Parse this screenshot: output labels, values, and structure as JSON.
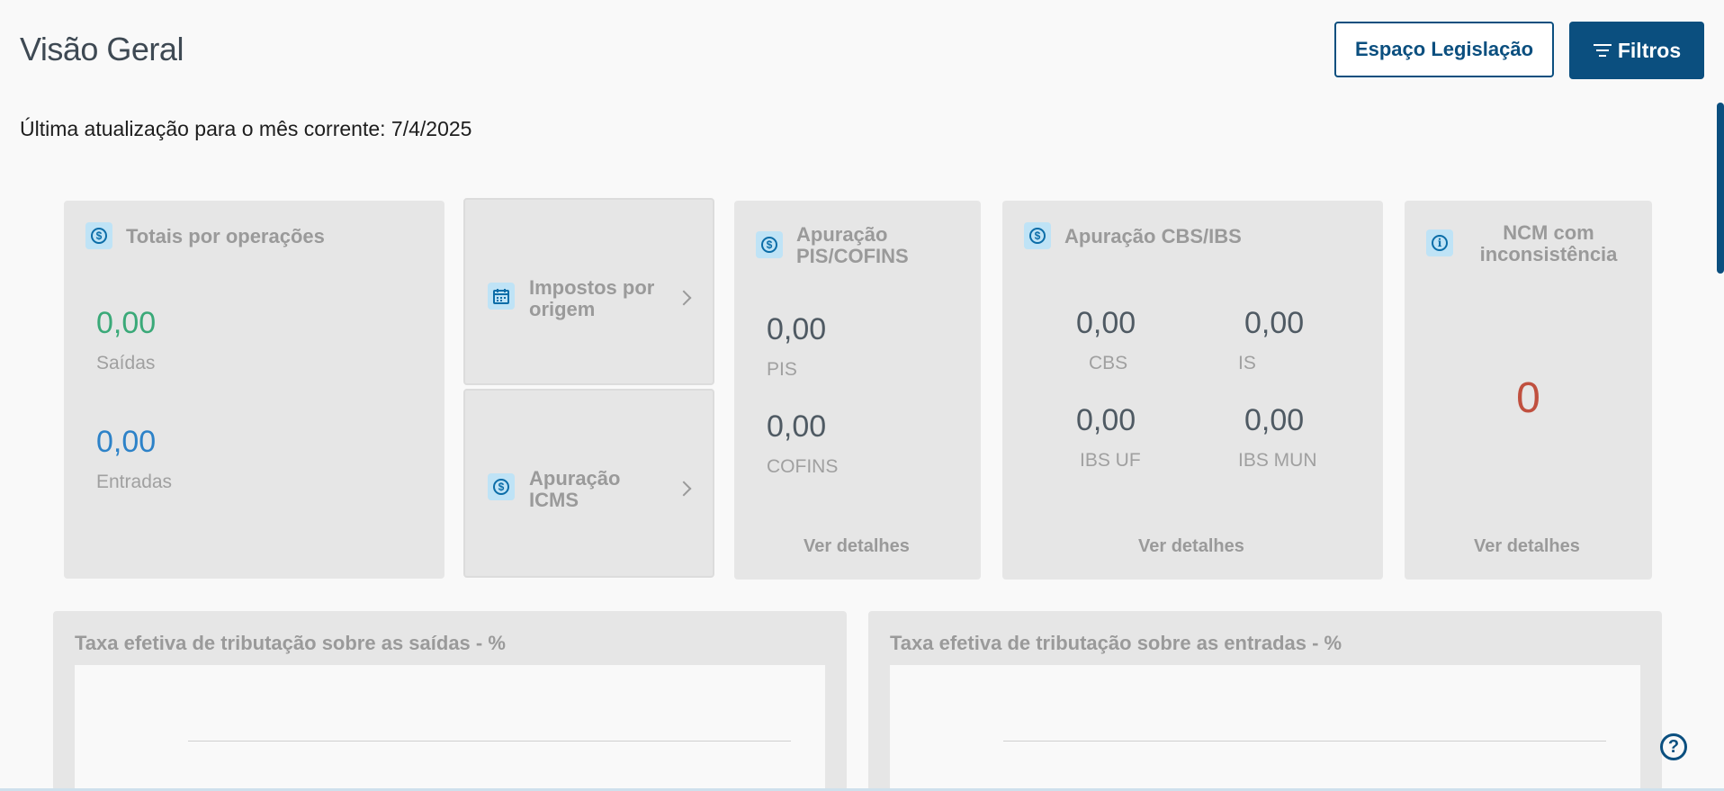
{
  "header": {
    "title": "Visão Geral",
    "legislation_button": "Espaço Legislação",
    "filters_button": "Filtros"
  },
  "last_update": "Última atualização para o mês corrente: 7/4/2025",
  "cards": {
    "totals": {
      "title": "Totais por operações",
      "icon": "dollar-coin-icon",
      "outputs_value": "0,00",
      "outputs_label": "Saídas",
      "inputs_value": "0,00",
      "inputs_label": "Entradas"
    },
    "taxes_origin": {
      "title_line1": "Impostos por",
      "title_line2": "origem",
      "icon": "calendar-icon"
    },
    "icms": {
      "title_line1": "Apuração",
      "title_line2": "ICMS",
      "icon": "dollar-coin-icon"
    },
    "pis_cofins": {
      "title_line1": "Apuração",
      "title_line2": "PIS/COFINS",
      "pis_value": "0,00",
      "pis_label": "PIS",
      "cofins_value": "0,00",
      "cofins_label": "COFINS",
      "details": "Ver detalhes"
    },
    "cbs_ibs": {
      "title": "Apuração CBS/IBS",
      "cbs_value": "0,00",
      "cbs_label": "CBS",
      "is_value": "0,00",
      "is_label": "IS",
      "ibs_uf_value": "0,00",
      "ibs_uf_label": "IBS UF",
      "ibs_mun_value": "0,00",
      "ibs_mun_label": "IBS MUN",
      "details": "Ver detalhes"
    },
    "ncm": {
      "title_line1": "NCM com",
      "title_line2": "inconsistência",
      "icon": "info-icon",
      "count": "0",
      "details": "Ver detalhes"
    }
  },
  "charts": {
    "outputs_title": "Taxa efetiva de tributação sobre as saídas - %",
    "inputs_title": "Taxa efetiva de tributação sobre as entradas - %"
  },
  "colors": {
    "primary": "#0b4f7f",
    "green": "#3aa978",
    "blue": "#2d82c8",
    "red": "#c0503f"
  }
}
